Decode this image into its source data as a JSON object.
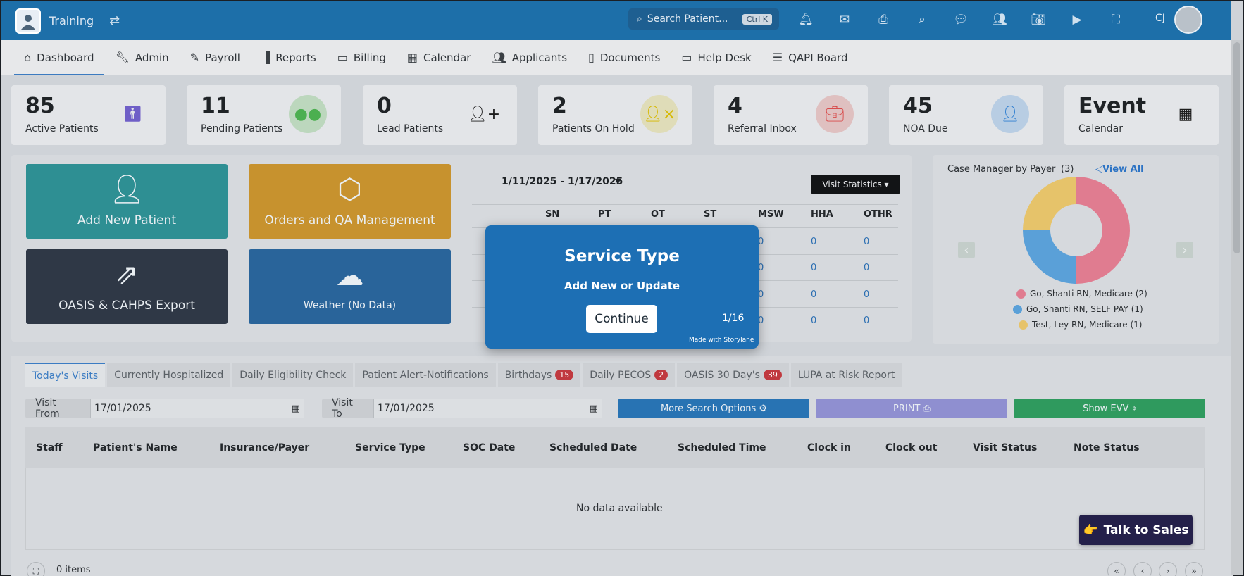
{
  "app": {
    "title": "Training",
    "search_placeholder": "Search Patient...",
    "search_shortcut": "Ctrl K",
    "user_initials": "CJ"
  },
  "nav": {
    "items": [
      {
        "label": "Dashboard",
        "icon": "home-icon"
      },
      {
        "label": "Admin",
        "icon": "wrench-icon"
      },
      {
        "label": "Payroll",
        "icon": "edit-icon"
      },
      {
        "label": "Reports",
        "icon": "bar-chart-icon"
      },
      {
        "label": "Billing",
        "icon": "clipboard-icon"
      },
      {
        "label": "Calendar",
        "icon": "calendar-icon"
      },
      {
        "label": "Applicants",
        "icon": "users-icon"
      },
      {
        "label": "Documents",
        "icon": "document-icon"
      },
      {
        "label": "Help Desk",
        "icon": "ticket-icon"
      },
      {
        "label": "QAPI Board",
        "icon": "checklist-icon"
      }
    ]
  },
  "stats": [
    {
      "value": "85",
      "label": "Active Patients",
      "icon": "person-icon",
      "color": "#6f5fc7"
    },
    {
      "value": "11",
      "label": "Pending Patients",
      "icon": "group-icon",
      "color": "#4caf50"
    },
    {
      "value": "0",
      "label": "Lead Patients",
      "icon": "user-plus-icon",
      "color": "#1d1d1d"
    },
    {
      "value": "2",
      "label": "Patients On Hold",
      "icon": "user-x-icon",
      "color": "#d6b800"
    },
    {
      "value": "4",
      "label": "Referral Inbox",
      "icon": "briefcase-icon",
      "color": "#d84c4c"
    },
    {
      "value": "45",
      "label": "NOA Due",
      "icon": "user-icon",
      "color": "#2f7fd1"
    },
    {
      "value": "Event",
      "label": "Calendar",
      "icon": "calendar-icon",
      "color": "#1d1d1d"
    }
  ],
  "tiles": {
    "add_patient": "Add New Patient",
    "orders": "Orders and QA Management",
    "oasis": "OASIS & CAHPS Export",
    "weather": "Weather (No Data)"
  },
  "visit_stats": {
    "date_range": "1/11/2025 - 1/17/2025",
    "button": "Visit Statistics",
    "columns": [
      "SN",
      "PT",
      "OT",
      "ST",
      "MSW",
      "HHA",
      "OTHR"
    ],
    "visible_values": [
      [
        "0",
        "0",
        "0"
      ],
      [
        "0",
        "0",
        "0"
      ],
      [
        "0",
        "0",
        "0"
      ],
      [
        "0",
        "0",
        "0"
      ]
    ]
  },
  "case_manager": {
    "title": "Case Manager by Payer",
    "count": "(3)",
    "view_all": "View All",
    "legend": [
      {
        "label": "Go, Shanti RN, Medicare (2)",
        "color": "#e07c90"
      },
      {
        "label": "Go, Shanti RN, SELF PAY  (1)",
        "color": "#5aa0d8"
      },
      {
        "label": "Test, Ley RN, Medicare (1)",
        "color": "#e6c36a"
      }
    ]
  },
  "chart_data": {
    "type": "pie",
    "title": "Case Manager by Payer",
    "categories": [
      "Go, Shanti RN, Medicare",
      "Go, Shanti RN, SELF PAY",
      "Test, Ley RN, Medicare"
    ],
    "values": [
      2,
      1,
      1
    ]
  },
  "tabs": [
    {
      "label": "Today's Visits",
      "badge": null
    },
    {
      "label": "Currently Hospitalized",
      "badge": null
    },
    {
      "label": "Daily Eligibility Check",
      "badge": null
    },
    {
      "label": "Patient Alert-Notifications",
      "badge": null
    },
    {
      "label": "Birthdays",
      "badge": "15"
    },
    {
      "label": "Daily PECOS",
      "badge": "2"
    },
    {
      "label": "OASIS 30 Day's",
      "badge": "39"
    },
    {
      "label": "LUPA at Risk Report",
      "badge": null
    }
  ],
  "filters": {
    "visit_from_label": "Visit From",
    "visit_from_value": "17/01/2025",
    "visit_to_label": "Visit To",
    "visit_to_value": "17/01/2025",
    "more_search": "More Search Options",
    "print": "PRINT",
    "show_evv": "Show EVV"
  },
  "table": {
    "headers": [
      "Staff",
      "Patient's Name",
      "Insurance/Payer",
      "Service Type",
      "SOC Date",
      "Scheduled Date",
      "Scheduled Time",
      "Clock in",
      "Clock out",
      "Visit Status",
      "Note Status"
    ],
    "empty": "No data available",
    "items": "0 items"
  },
  "modal": {
    "title": "Service Type",
    "subtitle": "Add New or Update",
    "button": "Continue",
    "step": "1/16",
    "made_with": "Made with Storylane"
  },
  "sales": {
    "label": "Talk to Sales",
    "emoji": "👉"
  }
}
